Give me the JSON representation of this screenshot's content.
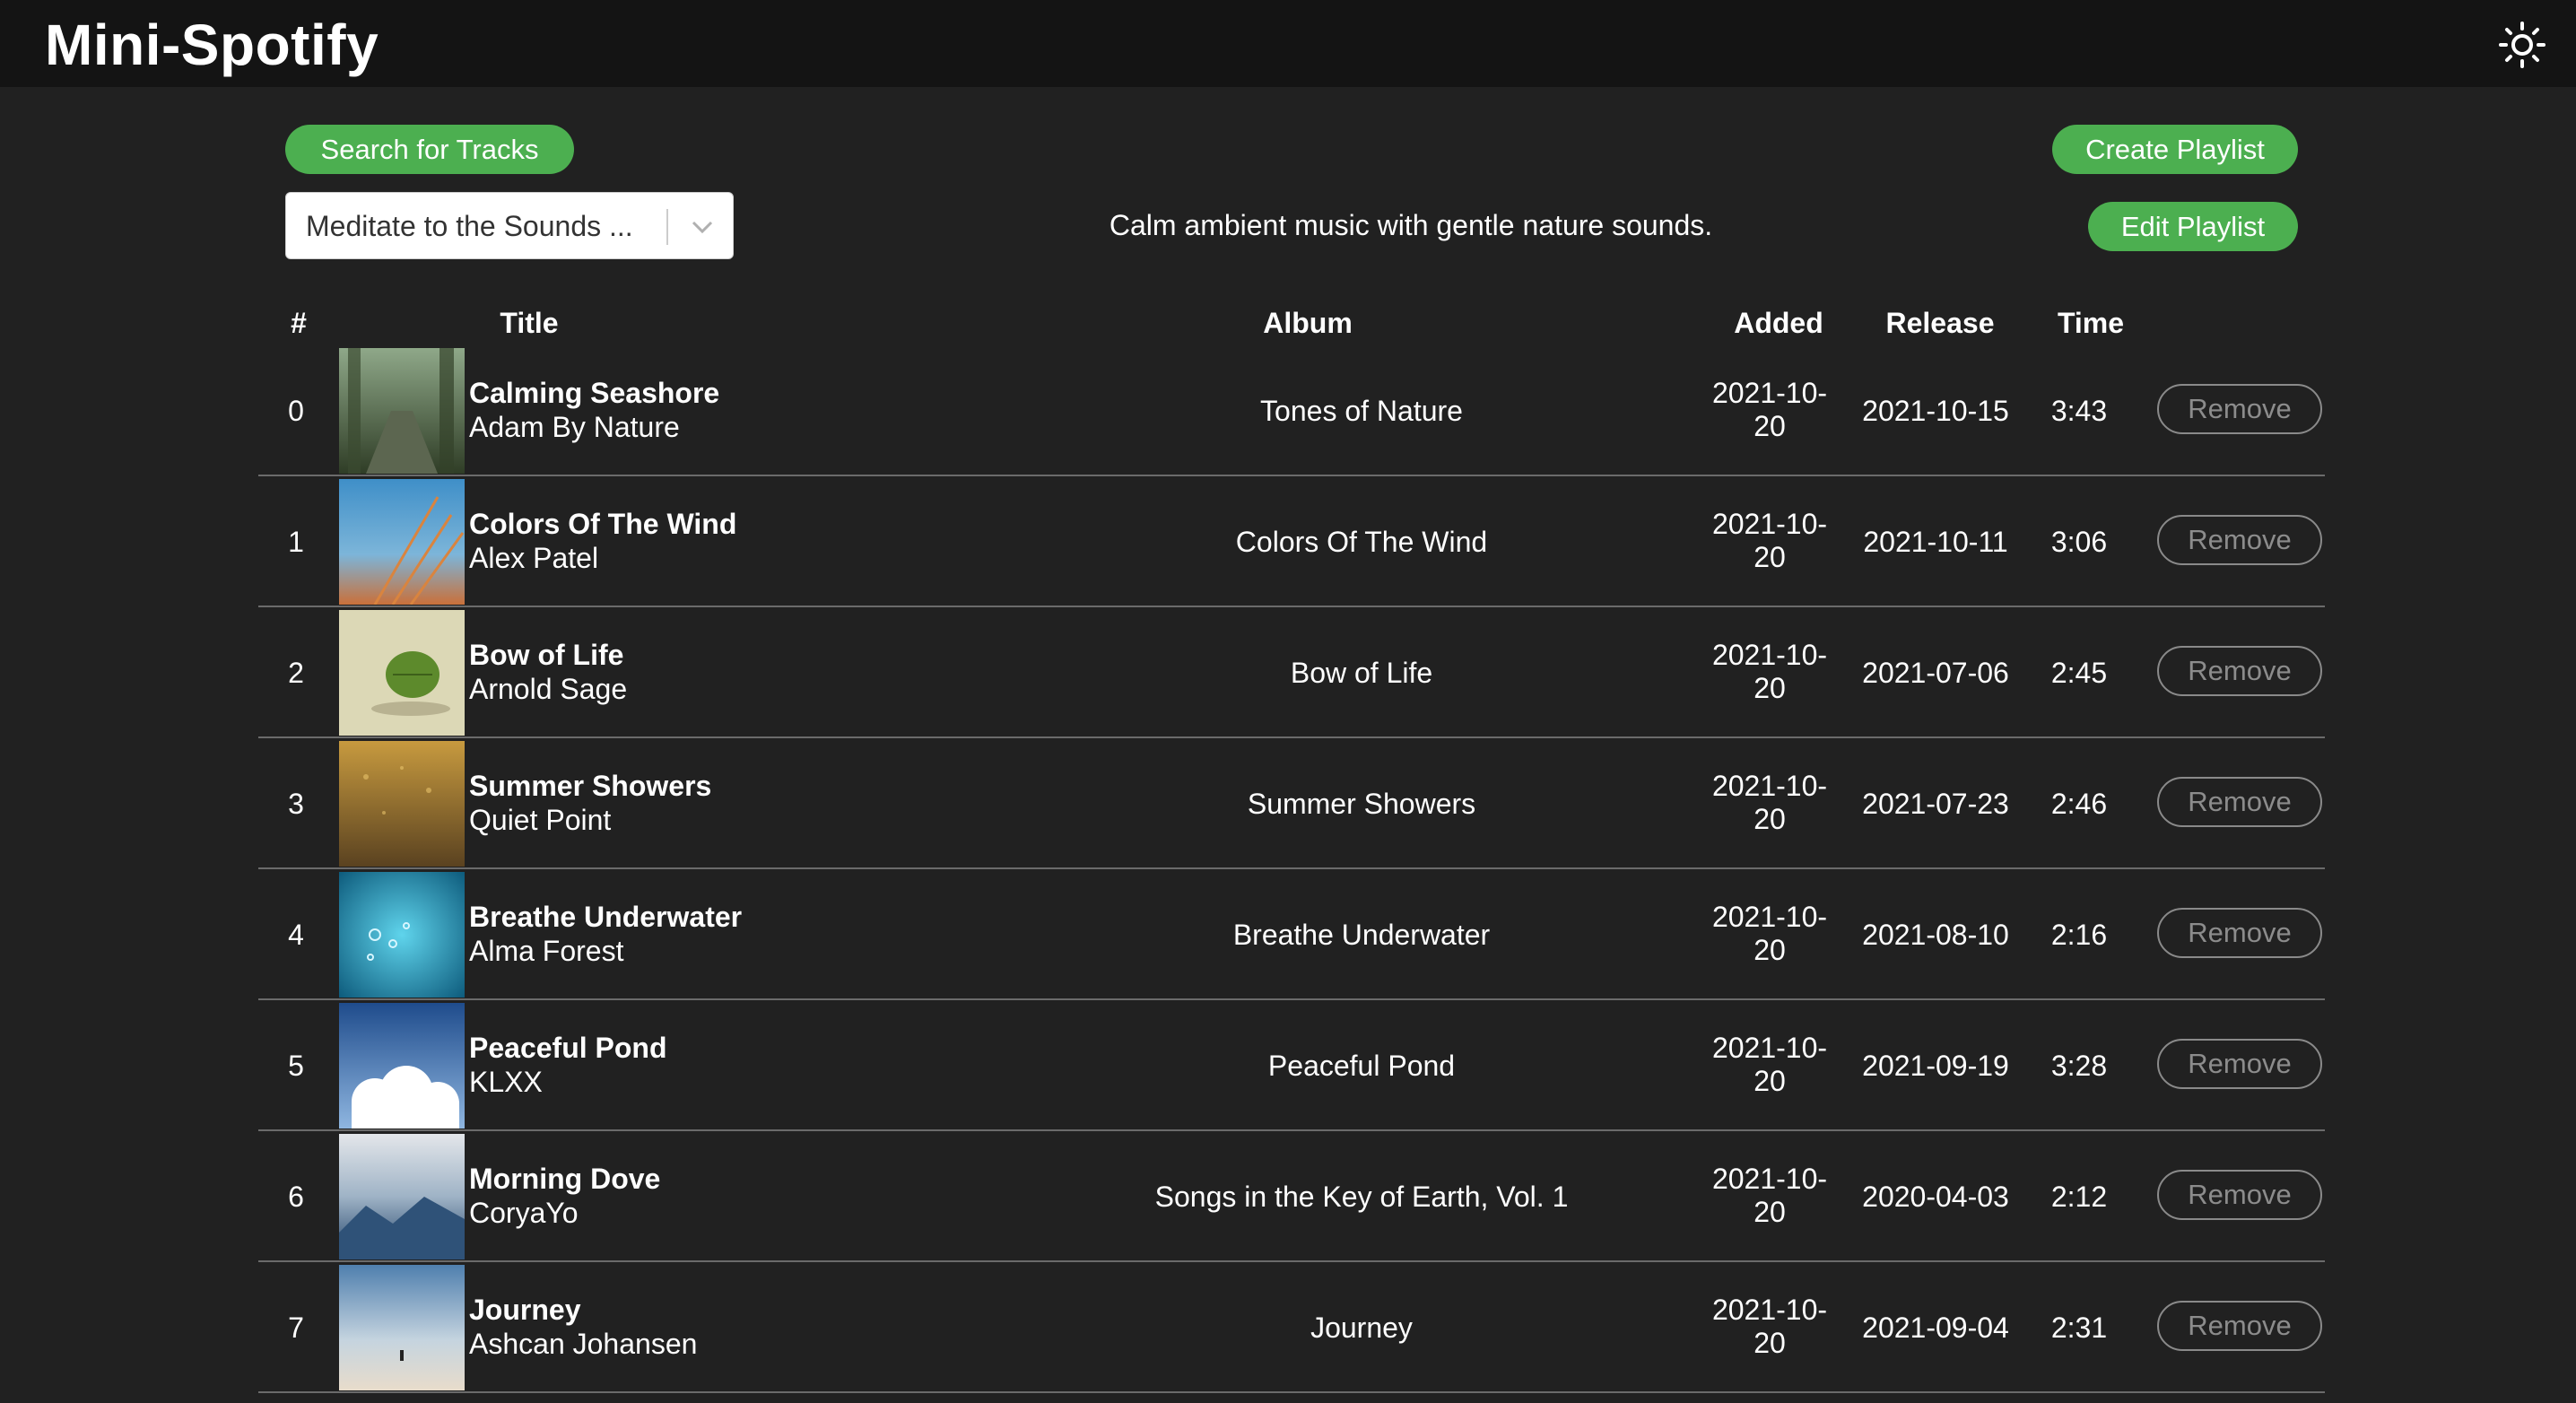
{
  "app": {
    "title": "Mini-Spotify",
    "theme_icon": "sun-icon"
  },
  "toolbar": {
    "search_label": "Search for Tracks",
    "create_label": "Create Playlist",
    "edit_label": "Edit Playlist"
  },
  "playlist": {
    "selected": "Meditate to the Sounds ...",
    "description": "Calm ambient music with gentle nature sounds."
  },
  "columns": {
    "num": "#",
    "title": "Title",
    "album": "Album",
    "added": "Added",
    "release": "Release",
    "time": "Time"
  },
  "tracks": [
    {
      "num": "0",
      "title": "Calming Seashore",
      "artist": "Adam By Nature",
      "album": "Tones of Nature",
      "added_a": "2021-10-",
      "added_b": "20",
      "release": "2021-10-15",
      "time": "3:43",
      "remove": "Remove"
    },
    {
      "num": "1",
      "title": "Colors Of The Wind",
      "artist": "Alex Patel",
      "album": "Colors Of The Wind",
      "added_a": "2021-10-",
      "added_b": "20",
      "release": "2021-10-11",
      "time": "3:06",
      "remove": "Remove"
    },
    {
      "num": "2",
      "title": "Bow of Life",
      "artist": "Arnold Sage",
      "album": "Bow of Life",
      "added_a": "2021-10-",
      "added_b": "20",
      "release": "2021-07-06",
      "time": "2:45",
      "remove": "Remove"
    },
    {
      "num": "3",
      "title": "Summer Showers",
      "artist": "Quiet Point",
      "album": "Summer Showers",
      "added_a": "2021-10-",
      "added_b": "20",
      "release": "2021-07-23",
      "time": "2:46",
      "remove": "Remove"
    },
    {
      "num": "4",
      "title": "Breathe Underwater",
      "artist": "Alma Forest",
      "album": "Breathe Underwater",
      "added_a": "2021-10-",
      "added_b": "20",
      "release": "2021-08-10",
      "time": "2:16",
      "remove": "Remove"
    },
    {
      "num": "5",
      "title": "Peaceful Pond",
      "artist": "KLXX",
      "album": "Peaceful Pond",
      "added_a": "2021-10-",
      "added_b": "20",
      "release": "2021-09-19",
      "time": "3:28",
      "remove": "Remove"
    },
    {
      "num": "6",
      "title": "Morning Dove",
      "artist": "CoryaYo",
      "album": "Songs in the Key of Earth, Vol. 1",
      "added_a": "2021-10-",
      "added_b": "20",
      "release": "2020-04-03",
      "time": "2:12",
      "remove": "Remove"
    },
    {
      "num": "7",
      "title": "Journey",
      "artist": "Ashcan Johansen",
      "album": "Journey",
      "added_a": "2021-10-",
      "added_b": "20",
      "release": "2021-09-04",
      "time": "2:31",
      "remove": "Remove"
    }
  ],
  "colors": {
    "accent": "#4caf50",
    "background": "#212121",
    "topbar": "#141414"
  }
}
